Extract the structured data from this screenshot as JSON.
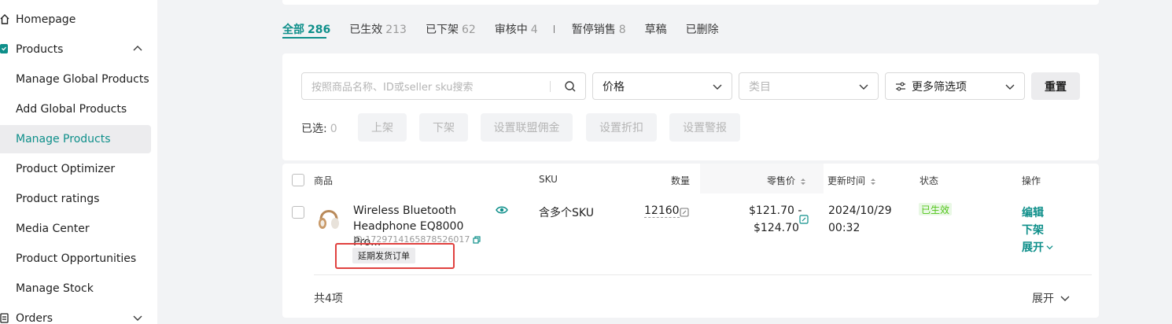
{
  "sidebar": {
    "homepage": "Homepage",
    "products": "Products",
    "items": [
      {
        "label": "Manage Global Products"
      },
      {
        "label": "Add Global Products"
      },
      {
        "label": "Manage Products"
      },
      {
        "label": "Product Optimizer"
      },
      {
        "label": "Product ratings"
      },
      {
        "label": "Media Center"
      },
      {
        "label": "Product Opportunities"
      },
      {
        "label": "Manage Stock"
      }
    ],
    "orders": "Orders"
  },
  "tabs": [
    {
      "label": "全部",
      "count": "286"
    },
    {
      "label": "已生效",
      "count": "213"
    },
    {
      "label": "已下架",
      "count": "62"
    },
    {
      "label": "审核中",
      "count": "4"
    },
    {
      "label": "暂停销售",
      "count": "8"
    },
    {
      "label": "草稿",
      "count": ""
    },
    {
      "label": "已删除",
      "count": ""
    }
  ],
  "filters": {
    "search_placeholder": "按照商品名称、ID或seller sku搜索",
    "price": "价格",
    "category_placeholder": "类目",
    "more_filters": "更多筛选项",
    "reset": "重置",
    "selected_label": "已选:",
    "selected_count": "0",
    "bulk": [
      "上架",
      "下架",
      "设置联盟佣金",
      "设置折扣",
      "设置警报"
    ]
  },
  "table": {
    "headers": {
      "product": "商品",
      "sku": "SKU",
      "quantity": "数量",
      "price": "零售价",
      "updated": "更新时间",
      "status": "状态",
      "actions": "操作"
    },
    "row": {
      "name_line1": "Wireless Bluetooth",
      "name_line2": "Headphone EQ8000 Pro...",
      "id": "ID:1729714165878526017",
      "tag": "延期发货订单",
      "sku": "含多个SKU",
      "quantity": "12160",
      "price_line1": "$121.70 -",
      "price_line2": "$124.70",
      "updated_line1": "2024/10/29",
      "updated_line2": "00:32",
      "status": "已生效",
      "action_edit": "编辑",
      "action_delist": "下架",
      "action_expand": "展开"
    },
    "footer": {
      "total": "共4项",
      "expand": "展开"
    }
  },
  "colors": {
    "accent": "#0e8f8a",
    "highlight_box": "#e0413f",
    "status_green": "#52c41a"
  }
}
